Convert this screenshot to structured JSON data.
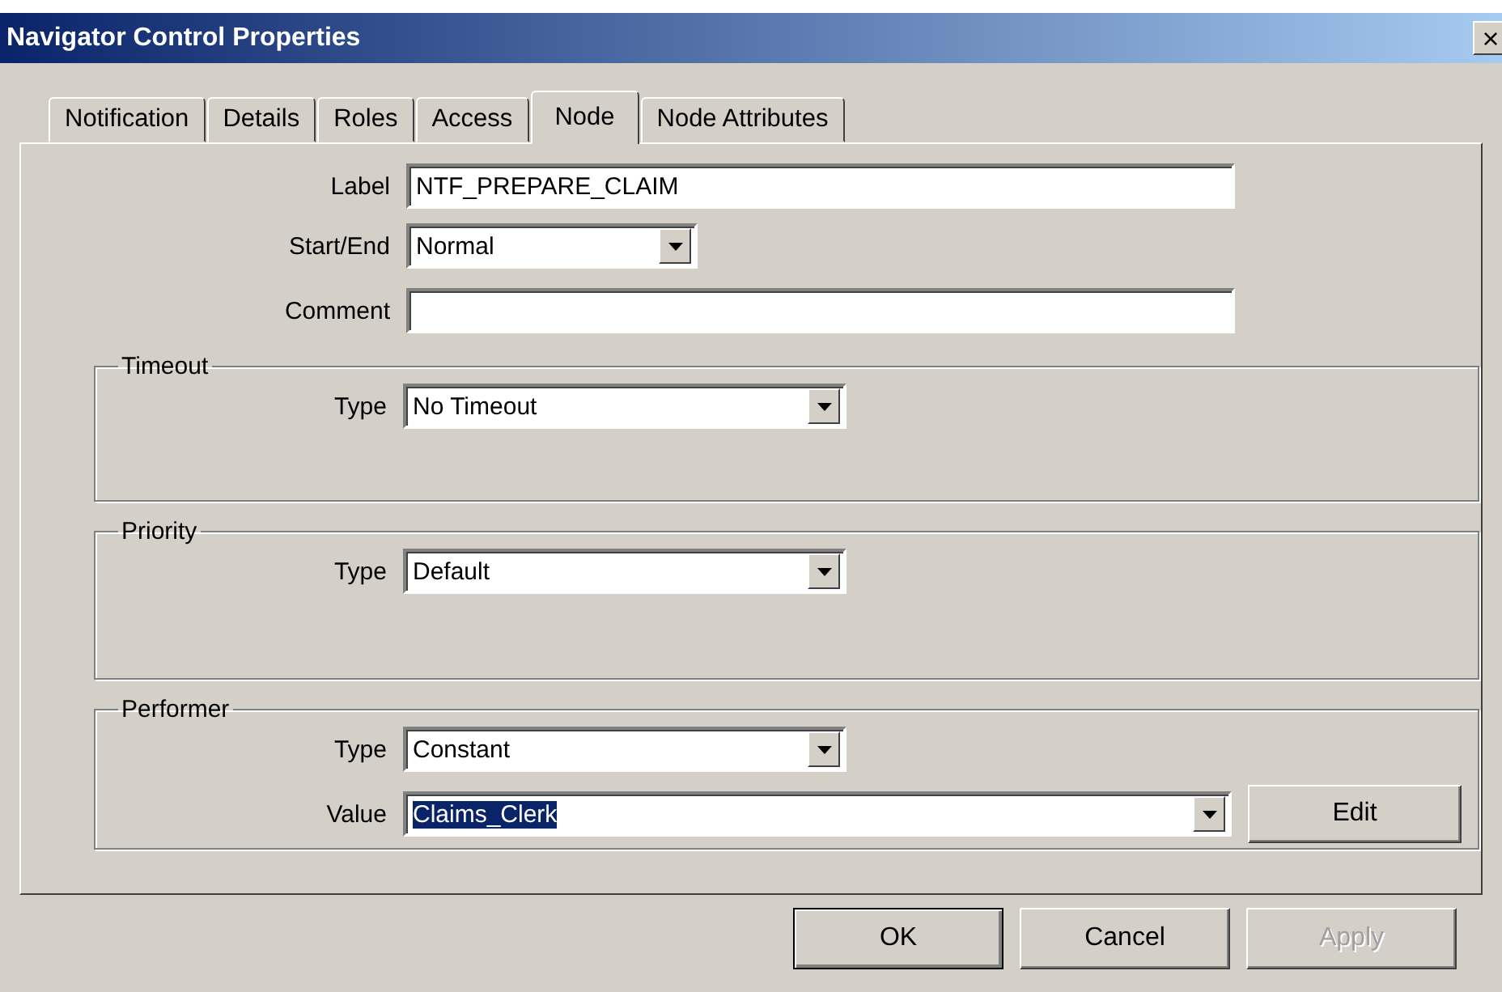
{
  "window": {
    "title": "Navigator Control Properties",
    "close": "×"
  },
  "tabs": [
    {
      "label": "Notification",
      "selected": false
    },
    {
      "label": "Details",
      "selected": false
    },
    {
      "label": "Roles",
      "selected": false
    },
    {
      "label": "Access",
      "selected": false
    },
    {
      "label": "Node",
      "selected": true
    },
    {
      "label": "Node Attributes",
      "selected": false
    }
  ],
  "fields": [
    {
      "label": "Label",
      "kind": "text",
      "value": "NTF_PREPARE_CLAIM"
    },
    {
      "label": "Start/End",
      "kind": "select",
      "value": "Normal"
    },
    {
      "label": "Comment",
      "kind": "text"
    }
  ],
  "groups": [
    {
      "title": "Timeout",
      "fields": [
        {
          "label": "Type",
          "kind": "select",
          "value": "No Timeout"
        }
      ]
    },
    {
      "title": "Priority",
      "fields": [
        {
          "label": "Type",
          "kind": "select",
          "value": "Default"
        }
      ]
    },
    {
      "title": "Performer",
      "fields": [
        {
          "label": "Type",
          "kind": "select",
          "value": "Constant"
        },
        {
          "label": "Value",
          "kind": "combo",
          "value": "Claims_Clerk",
          "text_selected": true,
          "button": "Edit"
        }
      ]
    }
  ],
  "buttons": [
    {
      "label": "OK",
      "default": true,
      "disabled": false
    },
    {
      "label": "Cancel",
      "default": false,
      "disabled": false
    },
    {
      "label": "Apply",
      "default": false,
      "disabled": true
    }
  ]
}
